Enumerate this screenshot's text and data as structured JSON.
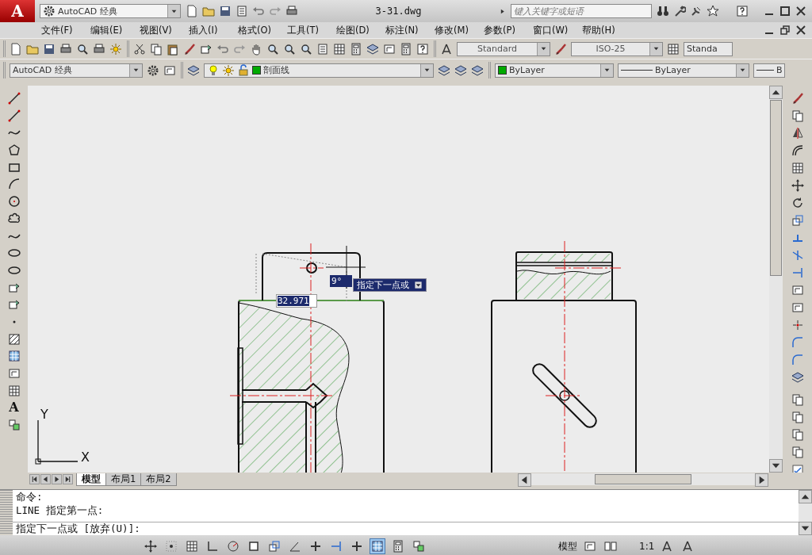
{
  "title_bar": {
    "app_logo": "A",
    "workspace": "AutoCAD 经典",
    "title": "3-31.dwg",
    "search": {
      "placeholder": "键入关键字或短语"
    }
  },
  "menu_bar": {
    "items": [
      "文件(F)",
      "编辑(E)",
      "视图(V)",
      "插入(I)",
      "格式(O)",
      "工具(T)",
      "绘图(D)",
      "标注(N)",
      "修改(M)",
      "参数(P)",
      "窗口(W)",
      "帮助(H)"
    ]
  },
  "styles_toolbar": {
    "text_style": "Standard",
    "dim_style": "ISO-25",
    "table_style": "Standa"
  },
  "layers_toolbar": {
    "workspace": "AutoCAD 经典",
    "layer": "剖面线"
  },
  "properties_toolbar": {
    "color_control": "ByLayer",
    "linetype": "ByLayer",
    "lineweight": "B"
  },
  "left_toolbar": {
    "text_tool": "A"
  },
  "drawing": {
    "dynamic_input": {
      "distance": "32.971",
      "angle": "9°",
      "prompt": "指定下一点或"
    },
    "ucs": {
      "x_label": "X",
      "y_label": "Y"
    }
  },
  "layout_tabs": [
    {
      "label": "模型",
      "selected": true
    },
    {
      "label": "布局1",
      "selected": false
    },
    {
      "label": "布局2",
      "selected": false
    }
  ],
  "command_window": {
    "history": [
      "命令:",
      "LINE 指定第一点:"
    ],
    "prompt": "指定下一点或 [放弃(U)]:"
  },
  "status_bar": {
    "toggles": [
      {
        "on": false
      },
      {
        "on": false
      },
      {
        "on": false
      },
      {
        "on": false
      },
      {
        "on": false
      },
      {
        "on": false
      },
      {
        "on": false
      },
      {
        "on": false
      },
      {
        "on": false
      },
      {
        "on": false
      },
      {
        "on": false
      },
      {
        "on": true
      },
      {
        "on": false
      },
      {
        "on": false
      }
    ],
    "space": "模型",
    "annotation_scale": "1:1"
  }
}
